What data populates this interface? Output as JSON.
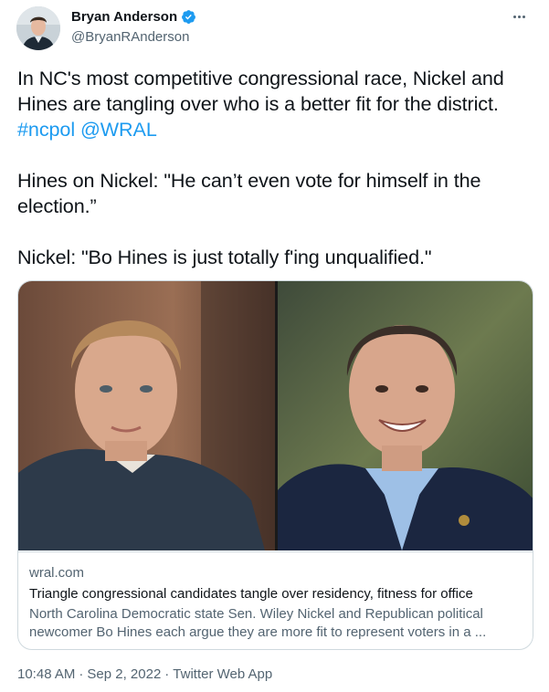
{
  "author": {
    "name": "Bryan Anderson",
    "handle": "@BryanRAnderson",
    "verified": true
  },
  "tweet": {
    "paragraph1_text": "In NC's most competitive congressional race, Nickel and Hines are tangling over who is a better fit for the district.",
    "hashtag": "#ncpol",
    "mention": "@WRAL",
    "paragraph2": "Hines on Nickel: \"He can’t even vote for himself in the election.”",
    "paragraph3": "Nickel: \"Bo Hines is just totally f'ing unqualified.\""
  },
  "card": {
    "domain": "wral.com",
    "title": "Triangle congressional candidates tangle over residency, fitness for office",
    "description": "North Carolina Democratic state Sen. Wiley Nickel and Republican political newcomer Bo Hines each argue they are more fit to represent voters in a ..."
  },
  "footer": {
    "time": "10:48 AM",
    "separator": "·",
    "date": "Sep 2, 2022",
    "separator2": "·",
    "source": "Twitter Web App"
  },
  "colors": {
    "link": "#1d9bf0",
    "secondary_text": "#536471",
    "border": "#cfd9de"
  },
  "icons": {
    "verified": "verified-badge-icon",
    "more": "more-options-icon"
  }
}
